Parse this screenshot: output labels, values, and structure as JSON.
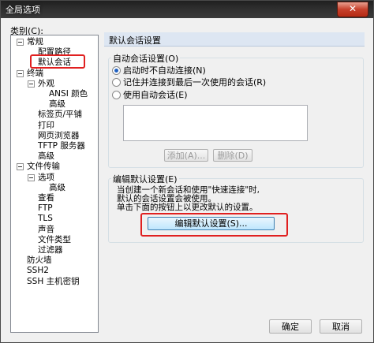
{
  "window": {
    "title": "全局选项",
    "close_glyph": "✕"
  },
  "category_label": "类别(C):",
  "tree": [
    {
      "label": "常规",
      "expandable": true
    },
    {
      "label": "配置路径"
    },
    {
      "label": "默认会话",
      "highlighted": true
    },
    {
      "label": "终端",
      "expandable": true
    },
    {
      "label": "外观",
      "expandable": true
    },
    {
      "label": "ANSI 颜色"
    },
    {
      "label": "高级"
    },
    {
      "label": "标签页/平铺"
    },
    {
      "label": "打印"
    },
    {
      "label": "网页浏览器"
    },
    {
      "label": "TFTP 服务器"
    },
    {
      "label": "高级"
    },
    {
      "label": "文件传输",
      "expandable": true
    },
    {
      "label": "选项",
      "expandable": true
    },
    {
      "label": "高级"
    },
    {
      "label": "查看"
    },
    {
      "label": "FTP"
    },
    {
      "label": "TLS"
    },
    {
      "label": "声音"
    },
    {
      "label": "文件类型"
    },
    {
      "label": "过滤器"
    },
    {
      "label": "防火墙"
    },
    {
      "label": "SSH2"
    },
    {
      "label": "SSH 主机密钥"
    }
  ],
  "panel": {
    "header": "默认会话设置",
    "auto_group": {
      "label": "自动会话设置(O)",
      "options": [
        {
          "label": "启动时不自动连接(N)",
          "checked": true
        },
        {
          "label": "记住并连接到最后一次使用的会话(R)",
          "checked": false
        },
        {
          "label": "使用自动会话(E)",
          "checked": false
        }
      ],
      "add_button": "添加(A)...",
      "delete_button": "删除(D)"
    },
    "edit_group": {
      "label": "编辑默认设置(E)",
      "description": [
        "当创建一个新会话和使用\"快速连接\"时,",
        "默认的会话设置会被使用。",
        "单击下面的按钮上以更改默认的设置。"
      ],
      "edit_button": "编辑默认设置(S)..."
    }
  },
  "footer": {
    "ok": "确定",
    "cancel": "取消"
  },
  "colors": {
    "annotation": "#e02020",
    "header_bg": "#dde6f2"
  }
}
